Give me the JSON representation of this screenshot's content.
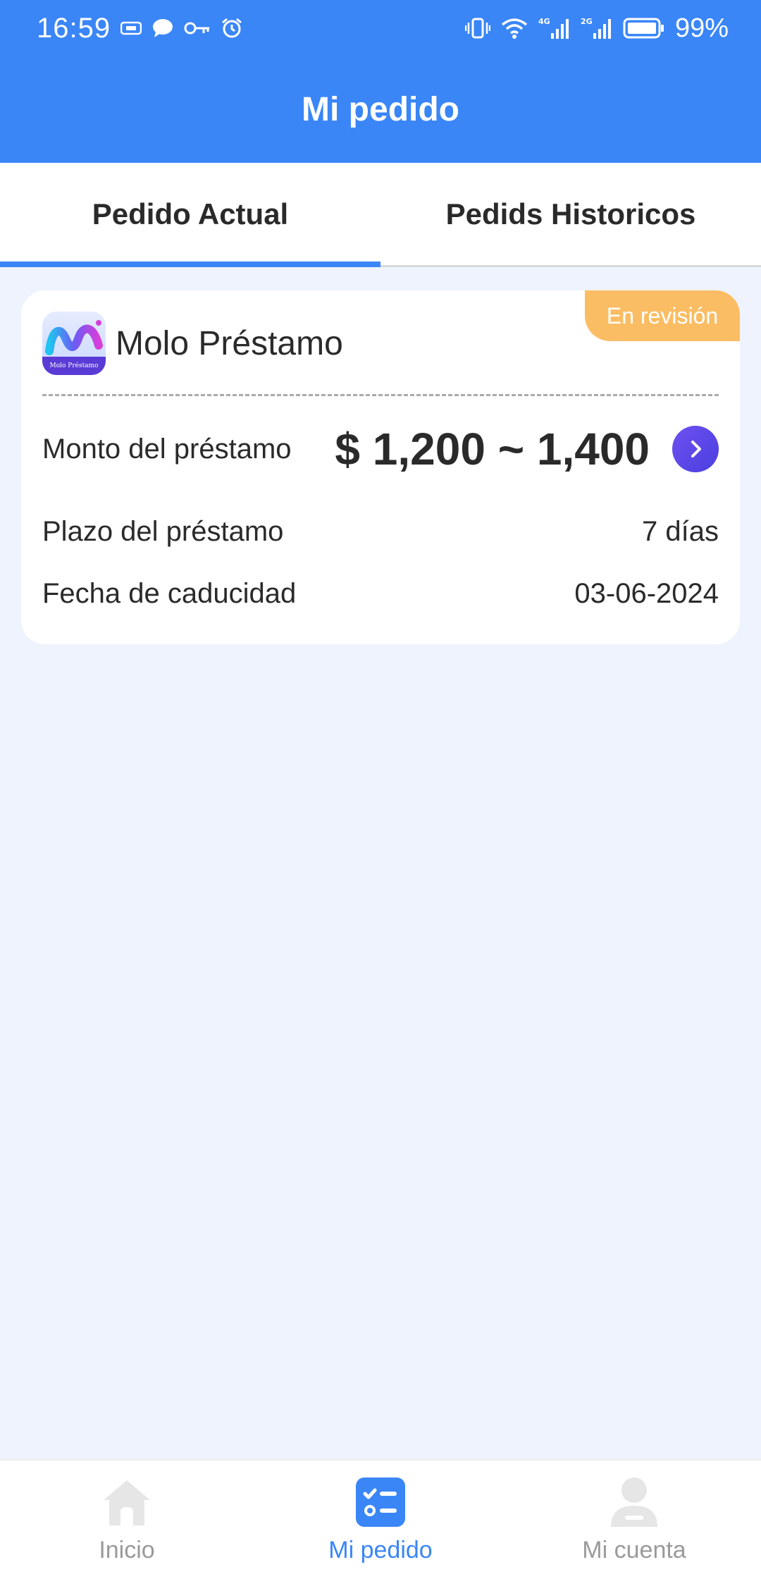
{
  "status_bar": {
    "time": "16:59",
    "battery": "99%"
  },
  "header": {
    "title": "Mi pedido"
  },
  "tabs": [
    {
      "label": "Pedido Actual",
      "active": true
    },
    {
      "label": "Pedids Historicos",
      "active": false
    }
  ],
  "order_card": {
    "status_badge": "En revisión",
    "brand_name": "Molo Préstamo",
    "logo_caption": "Molo Préstamo",
    "amount_label": "Monto del préstamo",
    "amount_value": "$ 1,200 ~ 1,400",
    "term_label": "Plazo del préstamo",
    "term_value": "7 días",
    "expiry_label": "Fecha de caducidad",
    "expiry_value": "03-06-2024"
  },
  "bottom_nav": [
    {
      "label": "Inicio",
      "icon": "home-icon",
      "active": false
    },
    {
      "label": "Mi pedido",
      "icon": "order-list-icon",
      "active": true
    },
    {
      "label": "Mi cuenta",
      "icon": "user-icon",
      "active": false
    }
  ],
  "colors": {
    "primary": "#3a86f7",
    "badge": "#fbbd63",
    "background": "#eef3fd",
    "accent_button": "#5a45e8"
  }
}
